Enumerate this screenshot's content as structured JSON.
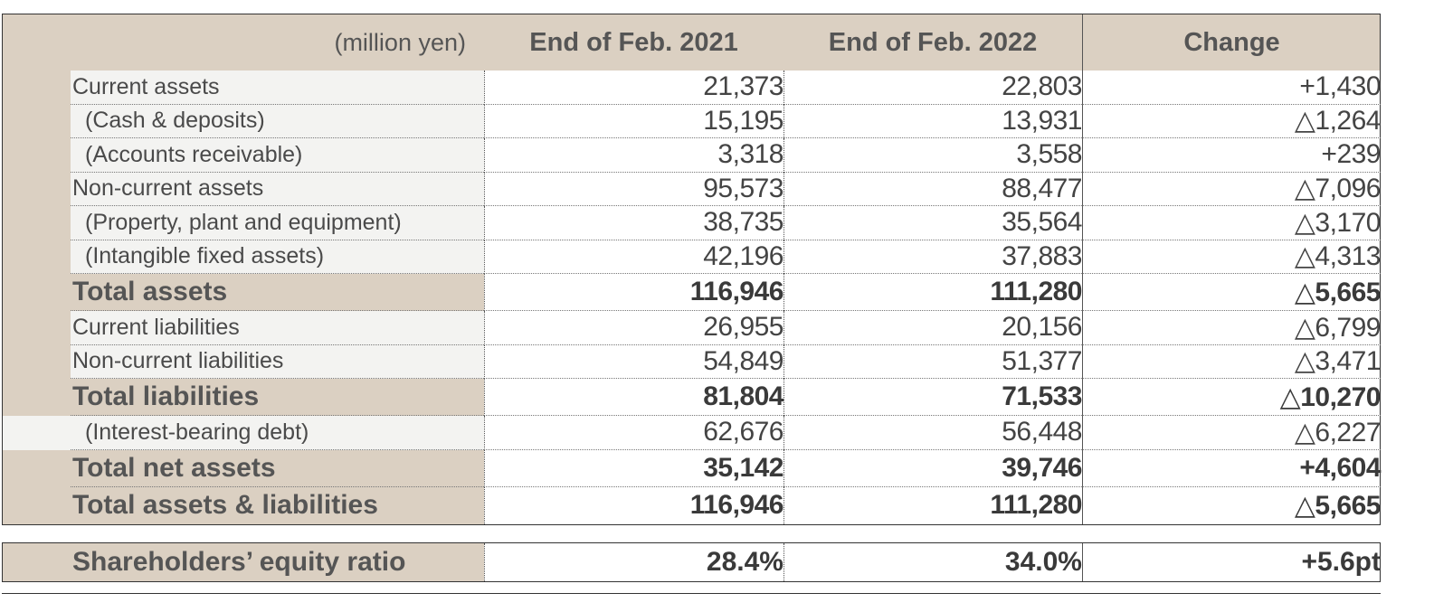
{
  "header": {
    "unit": "(million yen)",
    "col1": "End of Feb. 2021",
    "col2": "End of Feb. 2022",
    "col3": "Change"
  },
  "rows": [
    {
      "label": "Current assets",
      "v2021": "21,373",
      "v2022": "22,803",
      "change": "+1,430"
    },
    {
      "label": "(Cash & deposits)",
      "v2021": "15,195",
      "v2022": "13,931",
      "change": "△1,264"
    },
    {
      "label": "(Accounts receivable)",
      "v2021": "3,318",
      "v2022": "3,558",
      "change": "+239"
    },
    {
      "label": "Non-current assets",
      "v2021": "95,573",
      "v2022": "88,477",
      "change": "△7,096"
    },
    {
      "label": "(Property, plant and equipment)",
      "v2021": "38,735",
      "v2022": "35,564",
      "change": "△3,170"
    },
    {
      "label": "(Intangible fixed assets)",
      "v2021": "42,196",
      "v2022": "37,883",
      "change": "△4,313"
    },
    {
      "label": "Total assets",
      "v2021": "116,946",
      "v2022": "111,280",
      "change": "△5,665"
    },
    {
      "label": "Current liabilities",
      "v2021": "26,955",
      "v2022": "20,156",
      "change": "△6,799"
    },
    {
      "label": "Non-current liabilities",
      "v2021": "54,849",
      "v2022": "51,377",
      "change": "△3,471"
    },
    {
      "label": "Total liabilities",
      "v2021": "81,804",
      "v2022": "71,533",
      "change": "△10,270"
    },
    {
      "label": "(Interest-bearing debt)",
      "v2021": "62,676",
      "v2022": "56,448",
      "change": "△6,227"
    },
    {
      "label": "Total net assets",
      "v2021": "35,142",
      "v2022": "39,746",
      "change": "+4,604"
    },
    {
      "label": "Total assets & liabilities",
      "v2021": "116,946",
      "v2022": "111,280",
      "change": "△5,665"
    }
  ],
  "ratio": {
    "label": "Shareholders’ equity ratio",
    "v2021": "28.4%",
    "v2022": "34.0%",
    "change": "+5.6pt"
  }
}
